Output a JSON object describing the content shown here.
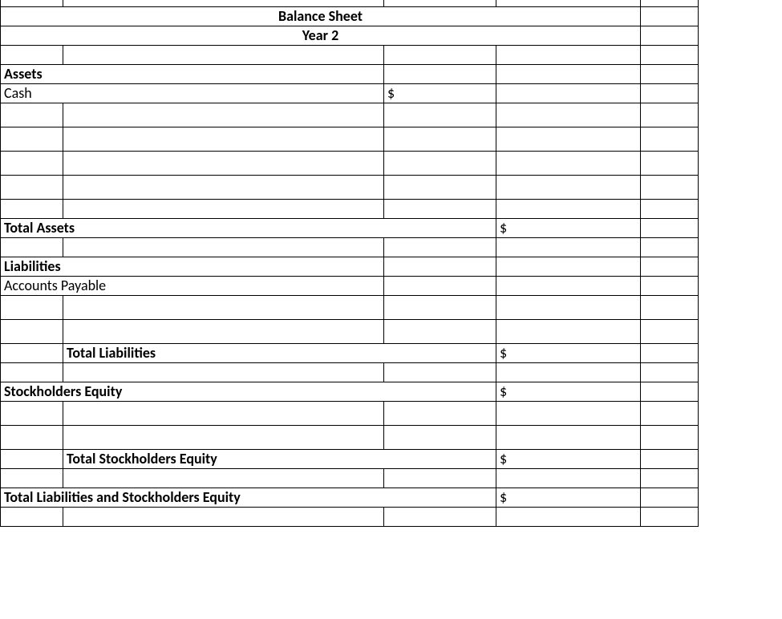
{
  "title": "Balance Sheet",
  "subtitle": "Year 2",
  "sections": {
    "assets": {
      "header": "Assets",
      "lines": {
        "cash": {
          "label": "Cash",
          "amount_symbol": "$",
          "amount": ""
        }
      },
      "total": {
        "label": "Total Assets",
        "amount_symbol": "$",
        "amount": ""
      }
    },
    "liabilities": {
      "header": "Liabilities",
      "lines": {
        "accounts_payable": {
          "label": "Accounts Payable",
          "amount_symbol": "",
          "amount": ""
        }
      },
      "total": {
        "label": "Total Liabilities",
        "amount_symbol": "$",
        "amount": ""
      }
    },
    "stockholders_equity": {
      "header": "Stockholders Equity",
      "header_amount_symbol": "$",
      "total": {
        "label": "Total Stockholders Equity",
        "amount_symbol": "$",
        "amount": ""
      }
    },
    "grand_total": {
      "label": "Total Liabilities and Stockholders Equity",
      "amount_symbol": "$",
      "amount": ""
    }
  }
}
